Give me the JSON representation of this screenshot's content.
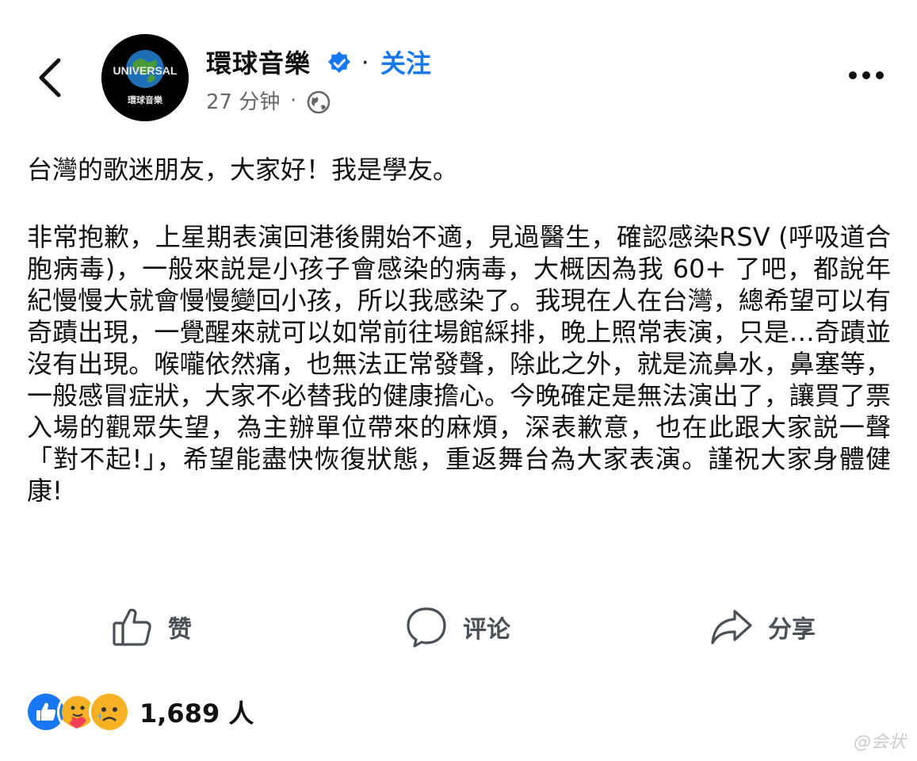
{
  "header": {
    "back_icon": "chevron-left-icon",
    "avatar_text": "UNIVERSAL",
    "avatar_subtext": "環球音樂",
    "page_name": "環球音樂",
    "verified_icon": "verified-badge-icon",
    "separator": "·",
    "follow_label": "关注",
    "time": "27 分钟",
    "time_separator": "·",
    "privacy_icon": "globe-icon",
    "more_icon": "more-horizontal-icon"
  },
  "post": {
    "paragraphs": [
      "台灣的歌迷朋友，大家好！我是學友。",
      "非常抱歉，上星期表演回港後開始不適，見過醫生，確認感染RSV (呼吸道合胞病毒)，一般來説是小孩子會感染的病毒，大概因為我 60+ 了吧，都說年紀慢慢大就會慢慢變回小孩，所以我感染了。我現在人在台灣，總希望可以有奇蹟出現，一覺醒來就可以如常前往場館綵排，晚上照常表演，只是…奇蹟並沒有出現。喉嚨依然痛，也無法正常發聲，除此之外，就是流鼻水，鼻塞等，一般感冒症狀，大家不必替我的健康擔心。今晚確定是無法演出了，讓買了票入場的觀眾失望，為主辦單位帶來的麻煩，深表歉意，也在此跟大家説一聲「對不起!」，希望能盡快恢復狀態，重返舞台為大家表演。謹祝大家身體健康!"
    ]
  },
  "actions": {
    "like_label": "赞",
    "comment_label": "评论",
    "share_label": "分享"
  },
  "reactions": {
    "icons": [
      "like-reaction-icon",
      "care-reaction-icon",
      "sad-reaction-icon"
    ],
    "count": "1,689 人"
  },
  "watermark": "@会状",
  "colors": {
    "accent": "#1877f2",
    "secondary_text": "#65676b",
    "text": "#111111"
  }
}
